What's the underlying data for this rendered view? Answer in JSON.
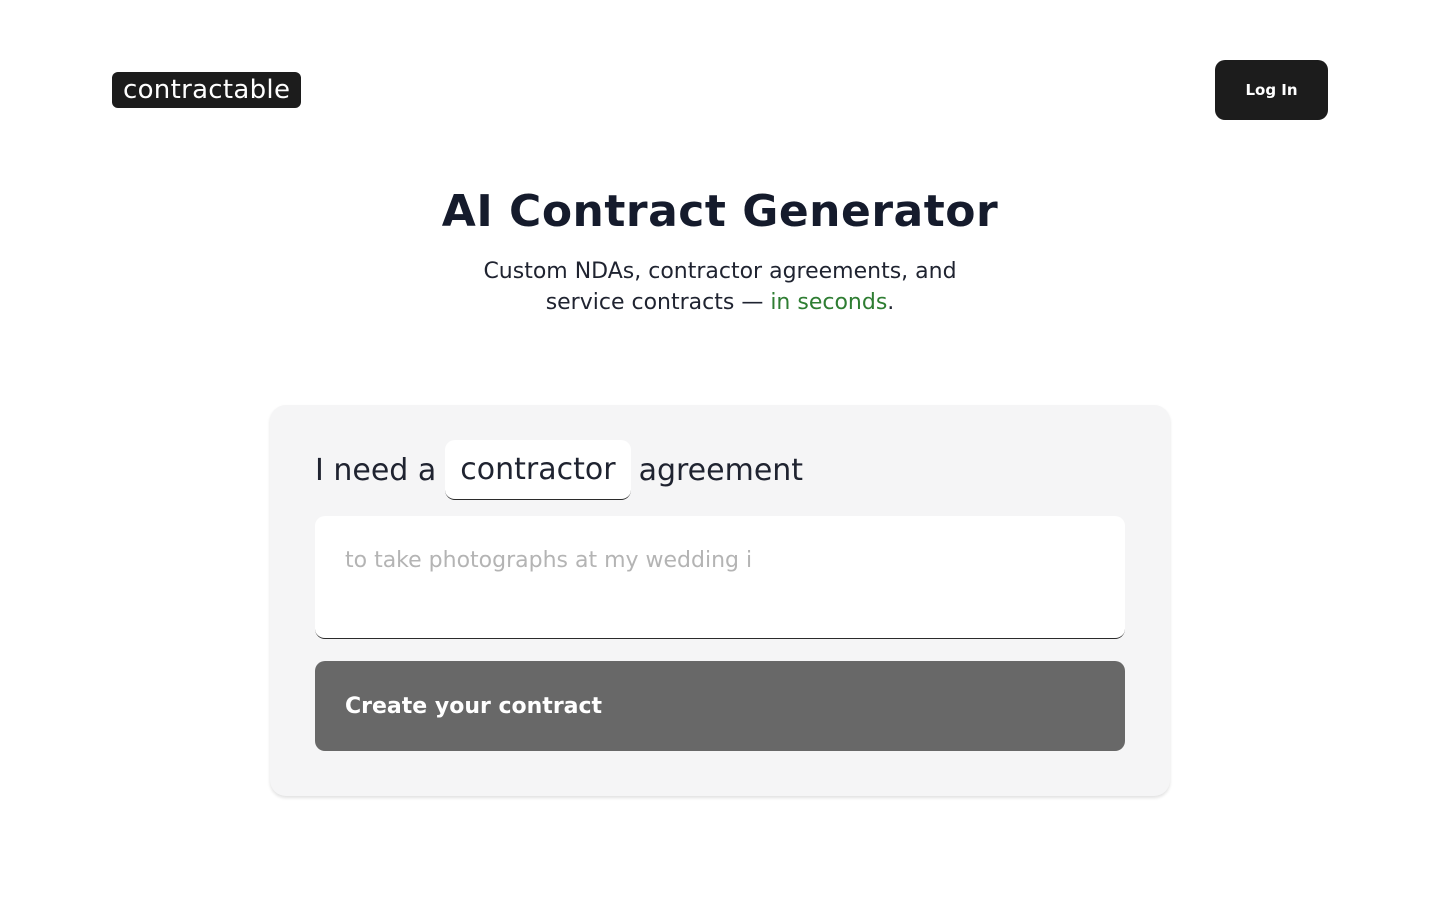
{
  "header": {
    "logo_text": "contractable",
    "login_label": "Log In"
  },
  "hero": {
    "title": "AI Contract Generator",
    "subtitle_line1": "Custom NDAs, contractor agreements, and",
    "subtitle_line2_pre": "service contracts — ",
    "subtitle_accent": "in seconds",
    "subtitle_end": "."
  },
  "form": {
    "prefix": "I need a",
    "contract_type": "contractor",
    "suffix": "agreement",
    "details_placeholder": "to take photographs at my wedding i",
    "details_value": "",
    "submit_label": "Create your contract"
  },
  "colors": {
    "accent": "#2e7d32",
    "button_dark": "#1c1c1c",
    "button_disabled": "#686868",
    "card_bg": "#f5f5f6"
  }
}
